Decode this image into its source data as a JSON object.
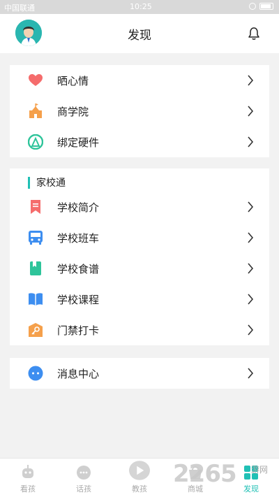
{
  "status_bar": {
    "carrier": "中国联通",
    "time": "10:25"
  },
  "header": {
    "title": "发现"
  },
  "group1": {
    "items": [
      {
        "label": "晒心情",
        "icon": "heart-icon",
        "color": "#f56c6c"
      },
      {
        "label": "商学院",
        "icon": "building-icon",
        "color": "#f5a04b"
      },
      {
        "label": "绑定硬件",
        "icon": "device-icon",
        "color": "#2ec49a"
      }
    ]
  },
  "group2": {
    "title": "家校通",
    "items": [
      {
        "label": "学校简介",
        "icon": "bookmark-icon",
        "color": "#f56c6c"
      },
      {
        "label": "学校班车",
        "icon": "bus-icon",
        "color": "#3d8ef0"
      },
      {
        "label": "学校食谱",
        "icon": "recipe-book-icon",
        "color": "#2ec49a"
      },
      {
        "label": "学校课程",
        "icon": "open-book-icon",
        "color": "#3d8ef0"
      },
      {
        "label": "门禁打卡",
        "icon": "key-icon",
        "color": "#f5a04b"
      }
    ]
  },
  "group3": {
    "items": [
      {
        "label": "消息中心",
        "icon": "chat-bubble-icon",
        "color": "#3d8ef0"
      }
    ]
  },
  "tabbar": {
    "tabs": [
      {
        "label": "看孩",
        "icon": "robot-icon"
      },
      {
        "label": "话孩",
        "icon": "chat-icon"
      },
      {
        "label": "教孩",
        "icon": "play-icon"
      },
      {
        "label": "商城",
        "icon": "shop-icon"
      },
      {
        "label": "发现",
        "icon": "discover-icon",
        "active": true
      }
    ]
  },
  "watermark": {
    "text": "2265",
    "sub": "游网"
  },
  "colors": {
    "accent": "#20c0b5",
    "background": "#f2f2f2"
  }
}
